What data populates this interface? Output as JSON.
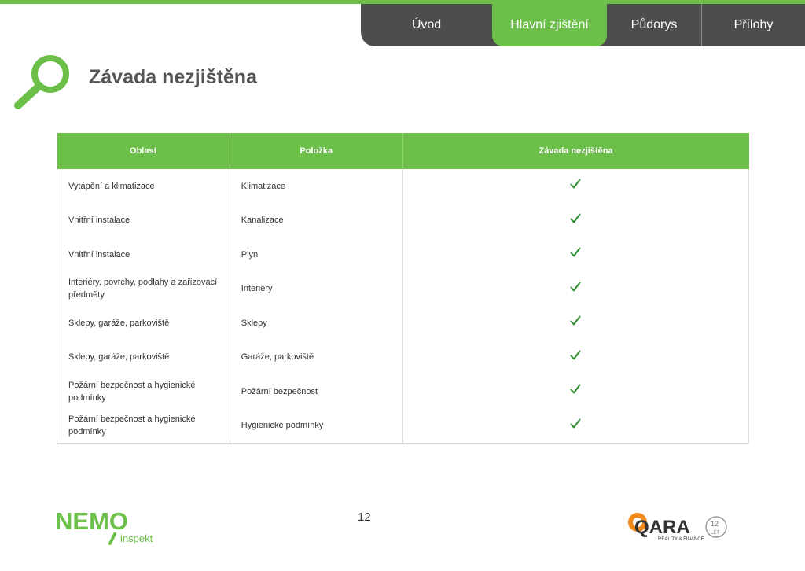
{
  "nav": {
    "tabs": [
      {
        "label": "Úvod",
        "active": false
      },
      {
        "label": "Hlavní zjištění",
        "active": true
      },
      {
        "label": "Půdorys",
        "active": false
      },
      {
        "label": "Přílohy",
        "active": false
      }
    ]
  },
  "page": {
    "title": "Závada nezjištěna",
    "number": "12"
  },
  "table": {
    "headers": [
      "Oblast",
      "Položka",
      "Závada nezjištěna"
    ],
    "rows": [
      {
        "oblast": "Vytápění a klimatizace",
        "polozka": "Klimatizace",
        "check": "✓"
      },
      {
        "oblast": "Vnitřní instalace",
        "polozka": "Kanalizace",
        "check": "✓"
      },
      {
        "oblast": "Vnitřní instalace",
        "polozka": "Plyn",
        "check": "✓"
      },
      {
        "oblast": "Interiéry, povrchy, podlahy a zařizovací předměty",
        "polozka": "Interiéry",
        "check": "✓"
      },
      {
        "oblast": "Sklepy, garáže, parkoviště",
        "polozka": "Sklepy",
        "check": "✓"
      },
      {
        "oblast": "Sklepy, garáže, parkoviště",
        "polozka": "Garáže, parkoviště",
        "check": "✓"
      },
      {
        "oblast": "Požární bezpečnost a hygienické podmínky",
        "polozka": "Požární bezpečnost",
        "check": "✓"
      },
      {
        "oblast": "Požární bezpečnost a hygienické podmínky",
        "polozka": "Hygienické podmínky",
        "check": "✓"
      }
    ]
  },
  "logos": {
    "left_brand": "NEMO",
    "left_sub": "inspekt",
    "right_brand": "QARA",
    "right_sub": "REALITY & FINANCE",
    "right_badge": "12 LET"
  },
  "colors": {
    "accent": "#6cc04a",
    "nav_bg": "#4d4d4d",
    "check": "#2e8b2e",
    "qara_orange": "#f08a1c"
  }
}
